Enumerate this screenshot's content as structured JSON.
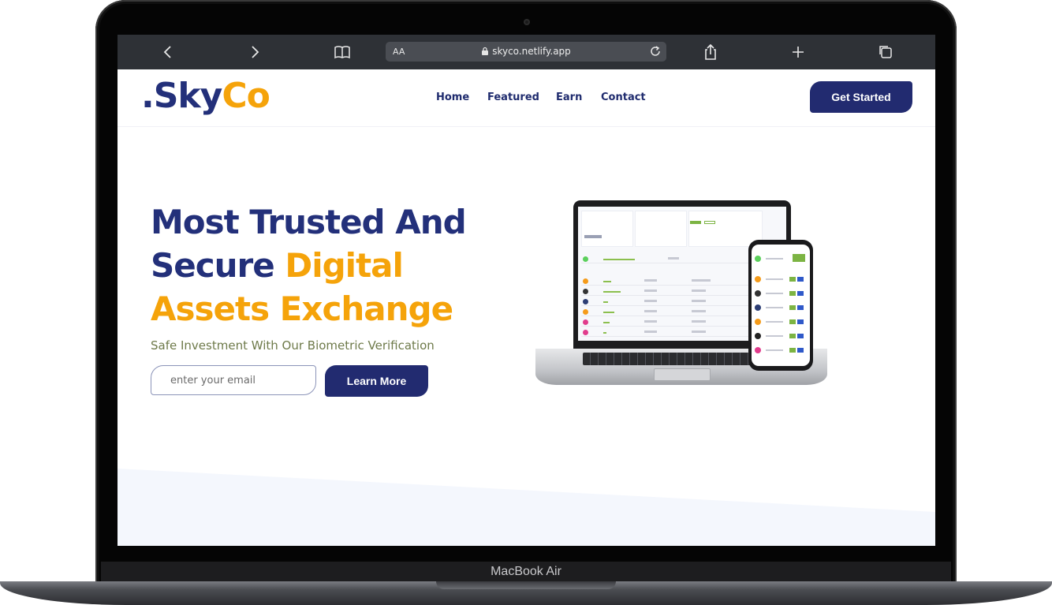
{
  "device": {
    "label": "MacBook Air"
  },
  "browser": {
    "text_size_label": "AA",
    "url": "skyco.netlify.app",
    "icons": [
      "back-icon",
      "forward-icon",
      "bookmarks-icon",
      "lock-icon",
      "reload-icon",
      "share-icon",
      "new-tab-icon",
      "tabs-icon"
    ]
  },
  "site": {
    "logo_part1": ".Sky",
    "logo_part2": "Co",
    "nav": [
      "Home",
      "Featured",
      "Earn",
      "Contact"
    ],
    "cta_label": "Get Started"
  },
  "hero": {
    "title_line1": "Most Trusted And",
    "title_line2_plain": "Secure ",
    "title_line2_accent": "Digital",
    "title_line3_accent": "Assets Exchange",
    "subtitle": "Safe Investment With Our Biometric Verification",
    "email_placeholder": "enter your email",
    "button_label": "Learn More"
  },
  "colors": {
    "brand_navy": "#23307a",
    "brand_orange": "#f5a30a",
    "subtitle_olive": "#6e7a4a",
    "browser_chrome": "#2e3136"
  }
}
